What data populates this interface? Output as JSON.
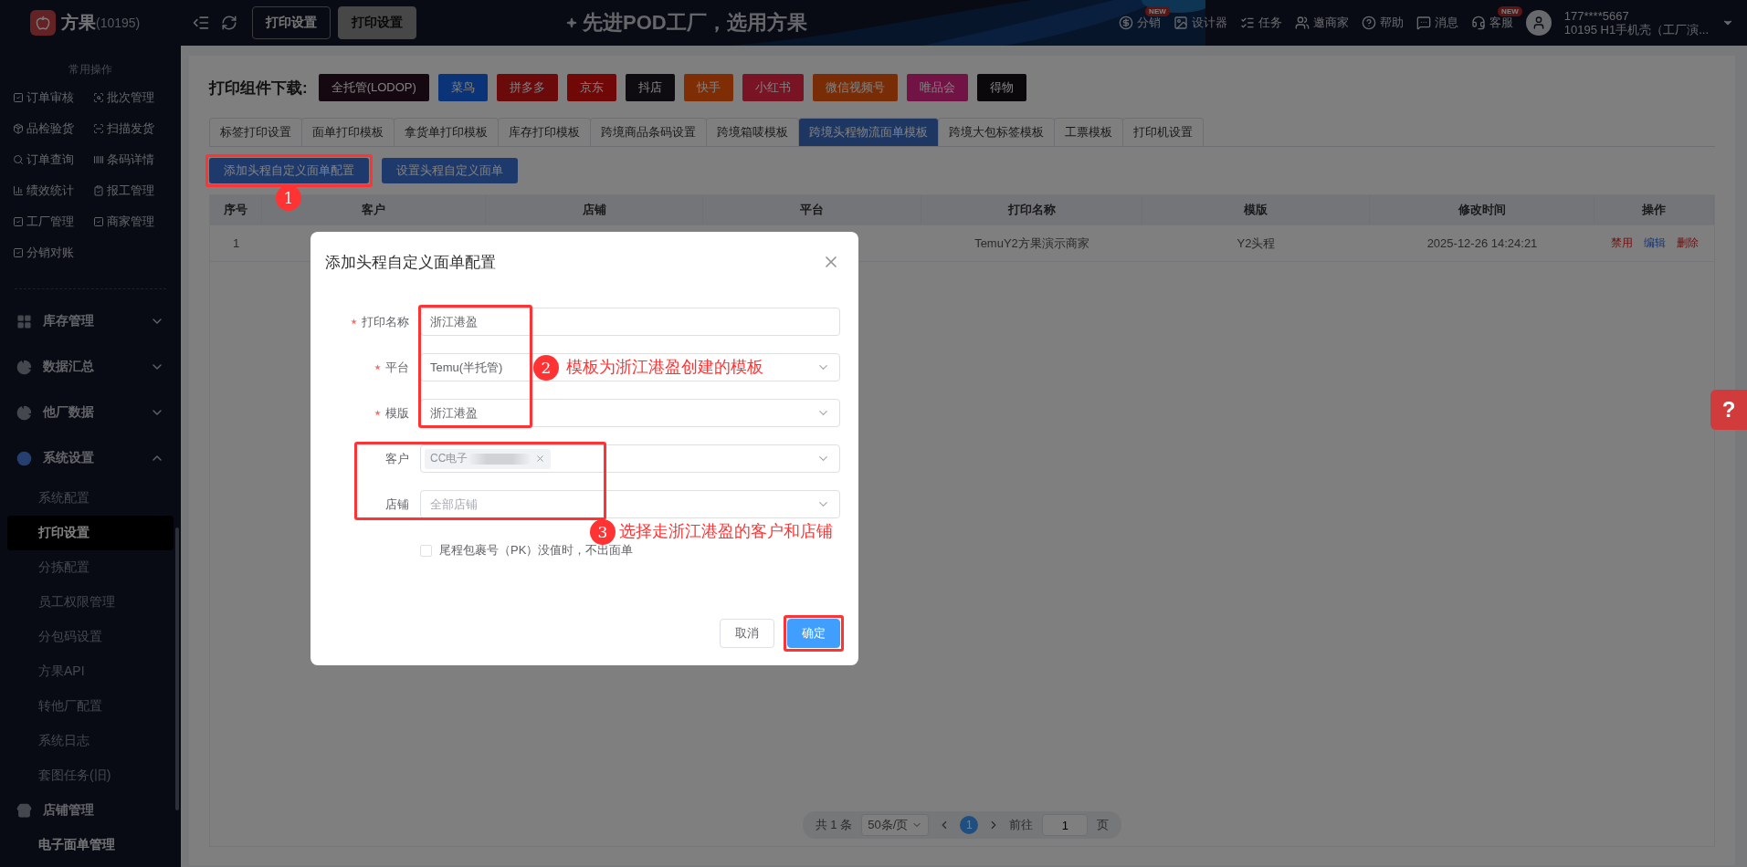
{
  "topbar": {
    "brand": "方果",
    "brand_id": "(10195)",
    "tabs": [
      {
        "label": "打印设置",
        "selected": false
      },
      {
        "label": "打印设置",
        "selected": true
      }
    ],
    "banner": "先进POD工厂，选用方果",
    "nav": [
      {
        "label": "分销",
        "badge": "NEW"
      },
      {
        "label": "设计器"
      },
      {
        "label": "任务"
      },
      {
        "label": "邀商家"
      },
      {
        "label": "帮助"
      },
      {
        "label": "消息"
      },
      {
        "label": "客服",
        "badge": "NEW"
      }
    ],
    "user": {
      "phone": "177****5667",
      "company": "10195  H1手机壳（工厂演..."
    }
  },
  "sidebar": {
    "quick_title": "常用操作",
    "quick": [
      "订单审核",
      "批次管理",
      "品检验货",
      "扫描发货",
      "订单查询",
      "条码详情",
      "绩效统计",
      "报工管理",
      "工厂管理",
      "商家管理",
      "分销对账"
    ],
    "menu": [
      {
        "label": "库存管理",
        "expanded": false
      },
      {
        "label": "数据汇总",
        "expanded": false
      },
      {
        "label": "他厂数据",
        "expanded": false
      },
      {
        "label": "系统设置",
        "expanded": true,
        "children": [
          {
            "label": "系统配置",
            "selected": false
          },
          {
            "label": "打印设置",
            "selected": true
          },
          {
            "label": "分拣配置",
            "selected": false
          },
          {
            "label": "员工权限管理",
            "selected": false
          },
          {
            "label": "分包码设置",
            "selected": false
          },
          {
            "label": "方果API",
            "selected": false
          },
          {
            "label": "转他厂配置",
            "selected": false
          },
          {
            "label": "系统日志",
            "selected": false
          },
          {
            "label": "套图任务(旧)",
            "selected": false
          }
        ]
      },
      {
        "label": "店铺管理",
        "children": [
          {
            "label": "电子面单管理",
            "selected": false,
            "kind": "group"
          }
        ]
      }
    ]
  },
  "downloads": {
    "title": "打印组件下载:",
    "items": [
      "全托管(LODOP)",
      "菜鸟",
      "拼多多",
      "京东",
      "抖店",
      "快手",
      "小红书",
      "微信视频号",
      "唯品会",
      "得物"
    ]
  },
  "tabs": [
    {
      "label": "标签打印设置",
      "selected": false
    },
    {
      "label": "面单打印模板",
      "selected": false
    },
    {
      "label": "拿货单打印模板",
      "selected": false
    },
    {
      "label": "库存打印模板",
      "selected": false
    },
    {
      "label": "跨境商品条码设置",
      "selected": false
    },
    {
      "label": "跨境箱唛模板",
      "selected": false
    },
    {
      "label": "跨境头程物流面单模板",
      "selected": true
    },
    {
      "label": "跨境大包标签模板",
      "selected": false
    },
    {
      "label": "工票模板",
      "selected": false
    },
    {
      "label": "打印机设置",
      "selected": false
    }
  ],
  "actions": [
    "添加头程自定义面单配置",
    "设置头程自定义面单"
  ],
  "table": {
    "columns": [
      "序号",
      "客户",
      "店铺",
      "平台",
      "打印名称",
      "模版",
      "修改时间",
      "操作"
    ],
    "rows": [
      {
        "index": "1",
        "print_name": "TemuY2方果演示商家",
        "template": "Y2头程",
        "modified": "2025-12-26 14:24:21",
        "actions": [
          {
            "label": "禁用",
            "kind": "danger"
          },
          {
            "label": "编辑",
            "kind": "normal"
          },
          {
            "label": "删除",
            "kind": "danger"
          }
        ]
      }
    ]
  },
  "pagination": {
    "total": "共 1 条",
    "page_size": "50条/页",
    "pages": [
      {
        "label": "1",
        "selected": true
      }
    ],
    "goto_label": "前往",
    "goto_value": "1",
    "goto_suffix": "页"
  },
  "help_tab": {
    "label": "?"
  },
  "modal": {
    "title": "添加头程自定义面单配置",
    "fields": [
      {
        "label": "打印名称",
        "required": true,
        "kind": "input",
        "value": "浙江港盈"
      },
      {
        "label": "平台",
        "required": true,
        "kind": "select",
        "value": "Temu(半托管)"
      },
      {
        "label": "模版",
        "required": true,
        "kind": "select",
        "value": "浙江港盈"
      },
      {
        "label": "客户",
        "required": false,
        "kind": "tags",
        "tags": [
          "CC电子"
        ]
      },
      {
        "label": "店铺",
        "required": false,
        "kind": "select",
        "placeholder": "全部店铺"
      }
    ],
    "checkbox": {
      "label": "尾程包裹号（PK）没值时，不出面单",
      "checked": false
    },
    "buttons": [
      {
        "label": "取消",
        "primary": false
      },
      {
        "label": "确定",
        "primary": true
      }
    ]
  },
  "annotations": [
    {
      "number": "1"
    },
    {
      "number": "2",
      "text": "模板为浙江港盈创建的模板"
    },
    {
      "number": "3",
      "text": "选择走浙江港盈的客户和店铺"
    }
  ]
}
